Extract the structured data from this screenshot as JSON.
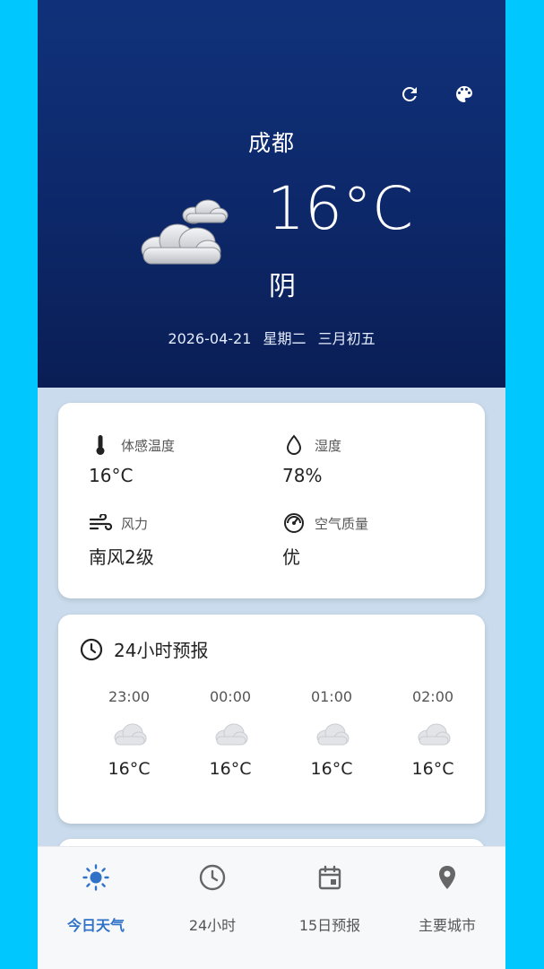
{
  "header": {
    "city": "成都",
    "temperature": "16°C",
    "condition": "阴",
    "date": "2026-04-21",
    "weekday": "星期二",
    "lunar": "三月初五",
    "refresh_icon": "refresh-icon",
    "theme_icon": "palette-icon"
  },
  "metrics": [
    {
      "label": "体感温度",
      "value": "16°C",
      "icon": "thermometer-icon"
    },
    {
      "label": "湿度",
      "value": "78%",
      "icon": "water-drop-icon"
    },
    {
      "label": "风力",
      "value": "南风2级",
      "icon": "wind-icon"
    },
    {
      "label": "空气质量",
      "value": "优",
      "icon": "air-quality-icon"
    }
  ],
  "forecast": {
    "title": "24小时预报",
    "hours": [
      {
        "time": "23:00",
        "temp": "16°C",
        "icon": "cloud-icon"
      },
      {
        "time": "00:00",
        "temp": "16°C",
        "icon": "cloud-icon"
      },
      {
        "time": "01:00",
        "temp": "16°C",
        "icon": "cloud-icon"
      },
      {
        "time": "02:00",
        "temp": "16°C",
        "icon": "cloud-icon"
      }
    ]
  },
  "nav": {
    "items": [
      {
        "label": "今日天气",
        "icon": "sun-icon",
        "active": true
      },
      {
        "label": "24小时",
        "icon": "clock-icon",
        "active": false
      },
      {
        "label": "15日预报",
        "icon": "calendar-icon",
        "active": false
      },
      {
        "label": "主要城市",
        "icon": "location-pin-icon",
        "active": false
      }
    ]
  },
  "colors": {
    "header_top": "#10317a",
    "header_bottom": "#0a1e55",
    "page_bg": "#c9dbec",
    "accent": "#2f72c7",
    "frame": "#00c8ff"
  }
}
